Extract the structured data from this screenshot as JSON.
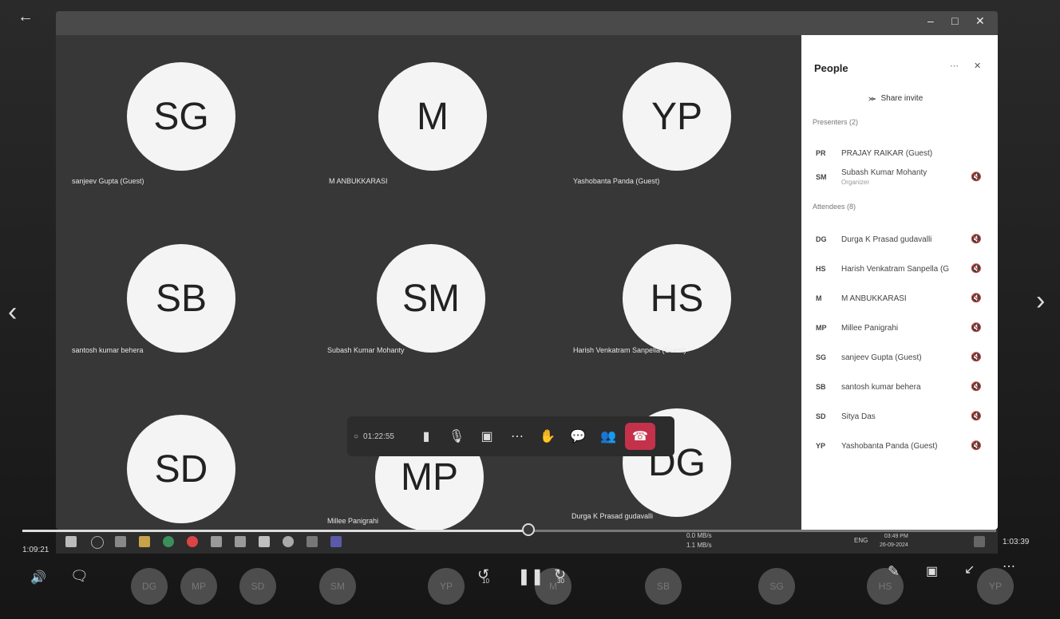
{
  "player": {
    "back_icon": "back-arrow-icon",
    "elapsed": "1:09:21",
    "remaining": "1:03:39",
    "progress_fraction": 0.52,
    "skip_back_label": "10",
    "skip_forward_label": "30"
  },
  "tiles": [
    {
      "initials": "SG",
      "name": "sanjeev Gupta (Guest)"
    },
    {
      "initials": "M",
      "name": "M ANBUKKARASI"
    },
    {
      "initials": "YP",
      "name": "Yashobanta Panda (Guest)"
    },
    {
      "initials": "SB",
      "name": "santosh kumar behera"
    },
    {
      "initials": "SM",
      "name": "Subash Kumar Mohanty"
    },
    {
      "initials": "HS",
      "name": "Harish Venkatram Sanpella (Guest)"
    },
    {
      "initials": "SD",
      "name": ""
    },
    {
      "initials": "MP",
      "name": "Millee Panigrahi"
    },
    {
      "initials": "DG",
      "name": "Durga K Prasad gudavalli"
    }
  ],
  "callbar": {
    "timer": "01:22:55"
  },
  "people": {
    "title": "People",
    "share_invite": "Share invite",
    "presenters_label": "Presenters (2)",
    "attendees_label": "Attendees (8)",
    "presenters": [
      {
        "initials": "PR",
        "name": "PRAJAY RAIKAR (Guest)",
        "sub": ""
      },
      {
        "initials": "SM",
        "name": "Subash Kumar Mohanty",
        "sub": "Organizer"
      }
    ],
    "attendees": [
      {
        "initials": "DG",
        "name": "Durga K Prasad gudavalli"
      },
      {
        "initials": "HS",
        "name": "Harish Venkatram Sanpella (G"
      },
      {
        "initials": "M",
        "name": "M ANBUKKARASI"
      },
      {
        "initials": "MP",
        "name": "Millee Panigrahi"
      },
      {
        "initials": "SG",
        "name": "sanjeev Gupta (Guest)"
      },
      {
        "initials": "SB",
        "name": "santosh kumar behera"
      },
      {
        "initials": "SD",
        "name": "Sitya Das"
      },
      {
        "initials": "YP",
        "name": "Yashobanta Panda (Guest)"
      }
    ]
  },
  "taskbar": {
    "net_down": "0.0 MB/s",
    "net_up": "1.1 MB/s",
    "lang": "ENG",
    "clock": "03:49 PM",
    "date": "26-09-2024"
  },
  "bubbles": [
    "DG",
    "MP",
    "SD",
    "SM",
    "YP",
    "M",
    "SB",
    "SG",
    "HS",
    "YP"
  ]
}
